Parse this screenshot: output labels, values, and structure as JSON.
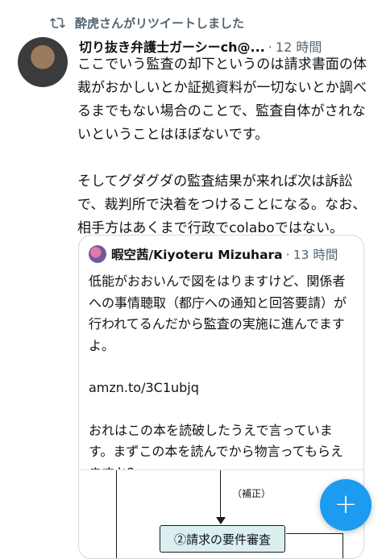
{
  "retweet": {
    "label": "酔虎さんがリツイートしました",
    "icon": "retweet-icon"
  },
  "tweet": {
    "author": "切り抜き弁護士ガーシーch@...",
    "separator": "·",
    "time": "12 時間",
    "more_icon": "more-icon",
    "paragraphs": [
      "ここでいう監査の却下というのは請求書面の体裁がおかしいとか証拠資料が一切ないとか調べるまでもない場合のことで、監査自体がされないということはほぼないです。",
      "そしてグダグダの監査結果が来れば次は訴訟で、裁判所で決着をつけることになる。なお、相手方はあくまで行政でcolaboではない。"
    ]
  },
  "quote": {
    "author": "暇空茜/Kiyoteru Mizuhara",
    "separator": "·",
    "time": "13 時間",
    "paragraphs": [
      "低能がおおいんで図をはりますけど、関係者への事情聴取（都庁への通知と回答要請）が行われてるんだから監査の実施に進んでますよ。",
      "amzn.to/3C1ubjq",
      "おれはこの本を読破したうえで言っています。まずこの本を読んでから物言ってもらえますか？"
    ],
    "image": {
      "note": "（補正）",
      "box_label": "②請求の要件審査"
    }
  },
  "fab": {
    "label": "+",
    "color": "#1d9bf0"
  },
  "colors": {
    "secondary_text": "#536471",
    "border": "#cfd9de",
    "accent": "#1d9bf0"
  }
}
